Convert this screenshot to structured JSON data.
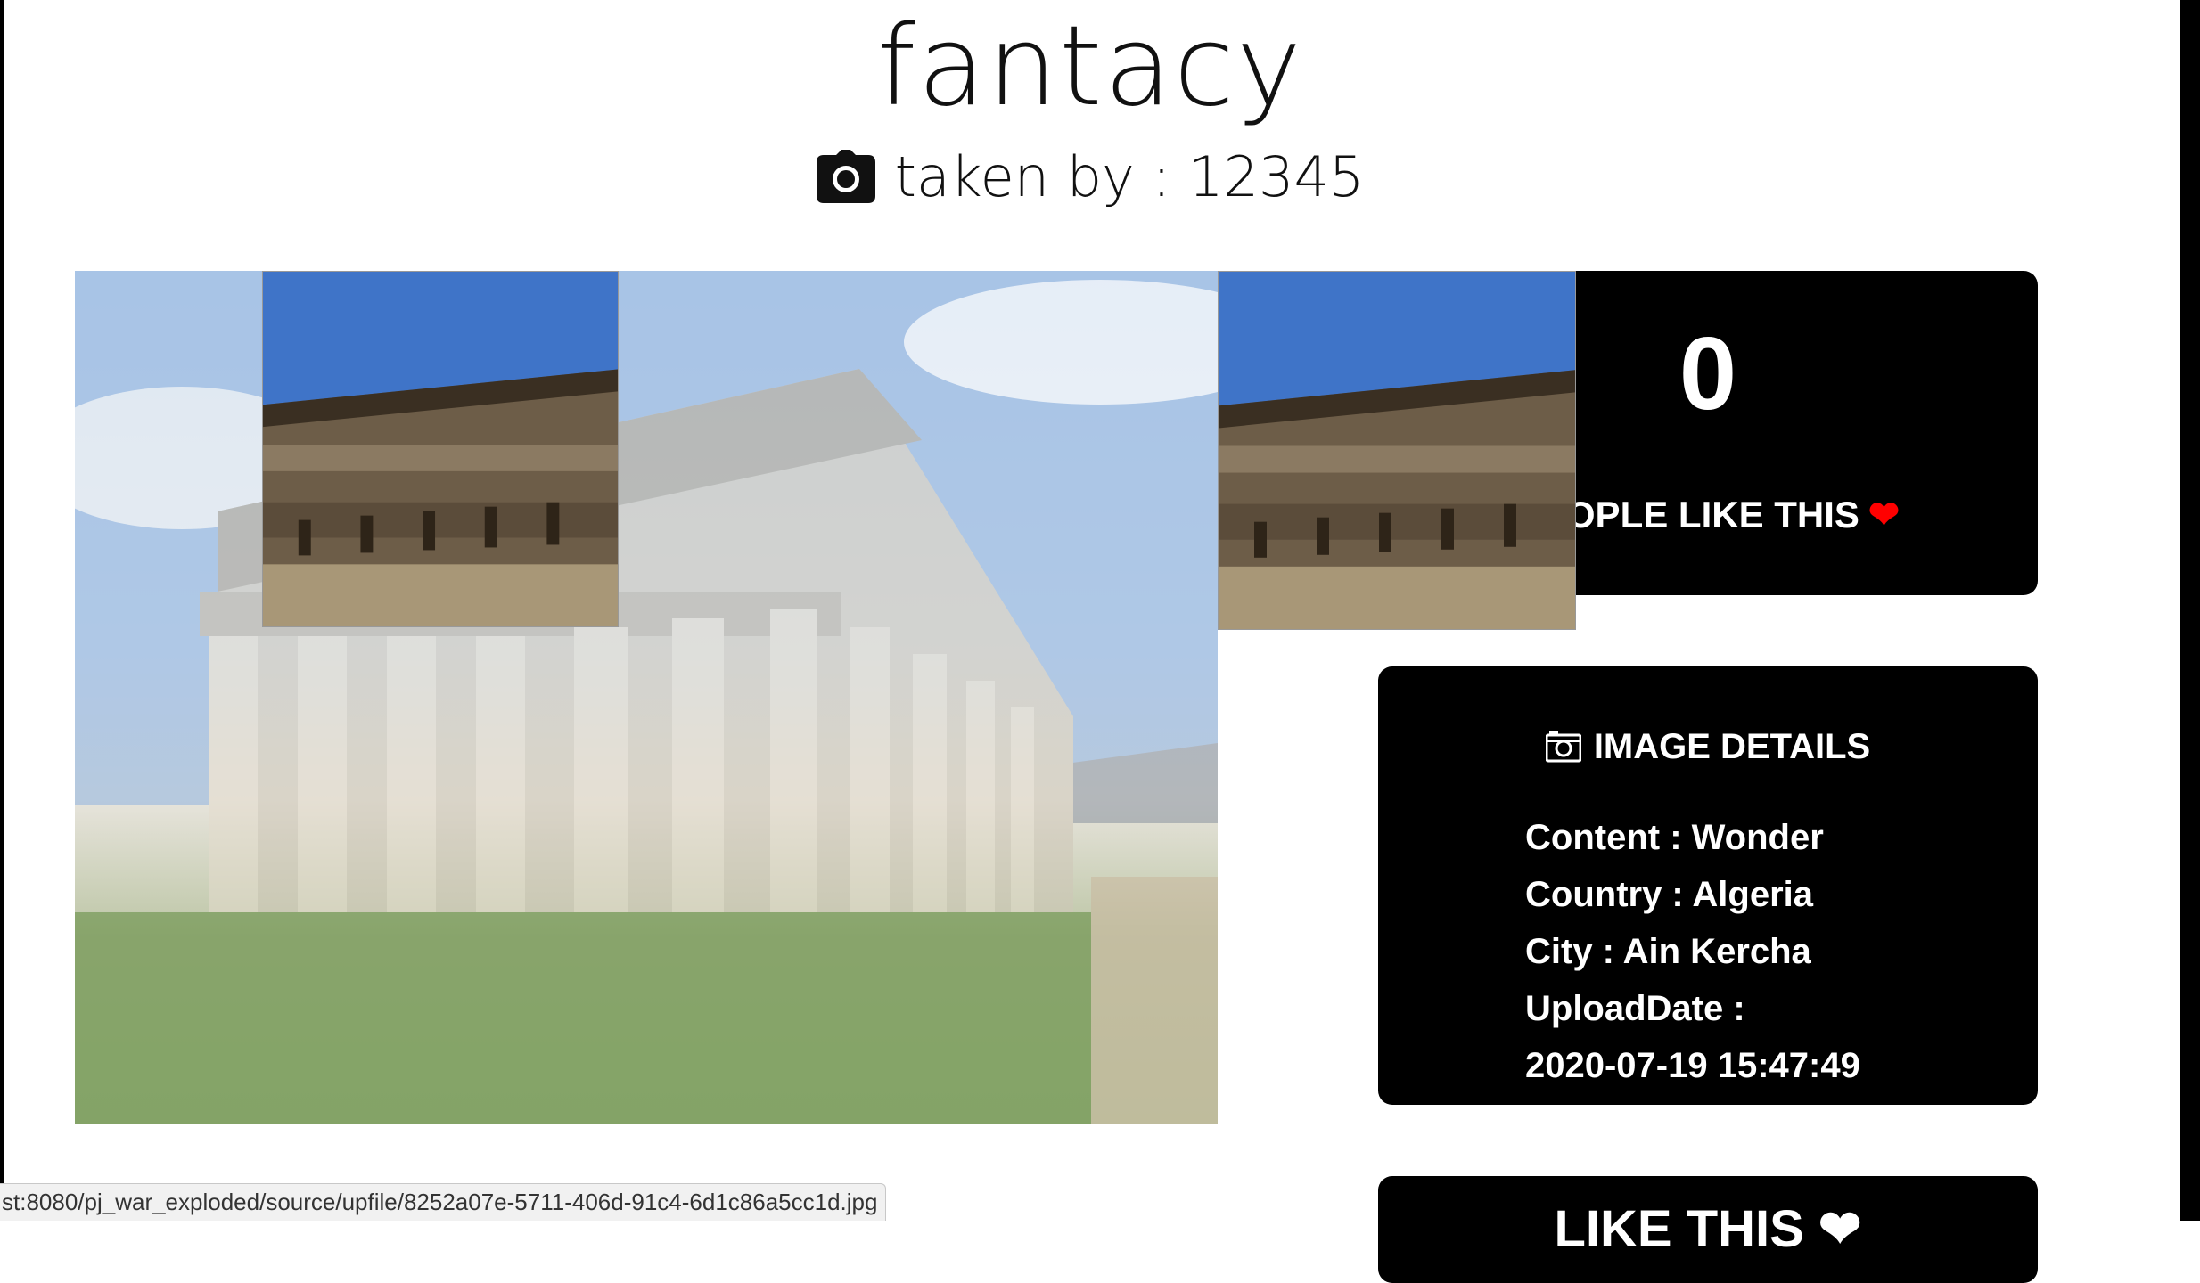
{
  "photo": {
    "title": "fantacy",
    "taken_by": "taken by : 12345"
  },
  "icons": {
    "author": "camera-icon",
    "details": "camera-icon",
    "likes": "heart-icon"
  },
  "likes": {
    "count": "0",
    "label": "PEOPLE LIKE THIS",
    "heart": "❤",
    "heart_color": "#ff0000"
  },
  "details": {
    "title": "IMAGE DETAILS",
    "content": "Content : Wonder",
    "country": "Country : Algeria",
    "city": "City : Ain Kercha",
    "upload_label": "UploadDate :",
    "upload_date": "2020-07-19 15:47:49"
  },
  "like_button": {
    "label": "LIKE THIS ❤"
  },
  "status_bar": {
    "url": "st:8080/pj_war_exploded/source/upfile/8252a07e-5711-406d-91c4-6d1c86a5cc1d.jpg"
  }
}
